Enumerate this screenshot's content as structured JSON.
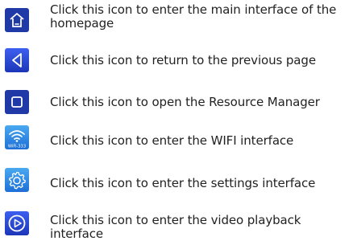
{
  "items": [
    {
      "icon": "home-icon",
      "text": "Click this icon to enter the main interface of the homepage"
    },
    {
      "icon": "back-icon",
      "text": "Click this icon to return to the previous page"
    },
    {
      "icon": "square-icon",
      "text": "Click this icon to open the Resource Manager"
    },
    {
      "icon": "wifi-icon",
      "text": "Click this icon to enter the WIFI interface",
      "badge": "WiFi-333"
    },
    {
      "icon": "gear-icon",
      "text": "Click this icon to enter the settings interface"
    },
    {
      "icon": "play-icon",
      "text": "Click this icon to enter the video playback interface"
    }
  ],
  "colors": {
    "icon_dark": "#1f3aa6",
    "icon_light": "#1d6fd6",
    "text": "#222222"
  }
}
